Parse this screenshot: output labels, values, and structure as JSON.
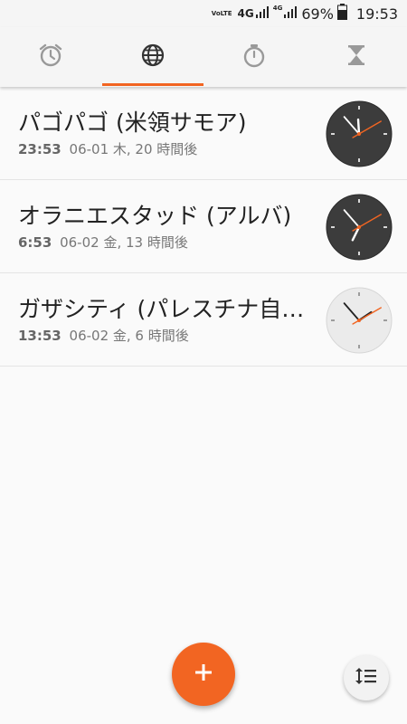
{
  "status_bar": {
    "volte": "VoLTE",
    "network1": "4G",
    "network2": "4G",
    "battery_percent": "69%",
    "time": "19:53"
  },
  "tabs": [
    {
      "name": "alarm",
      "icon": "alarm-clock-icon",
      "active": false
    },
    {
      "name": "world-clock",
      "icon": "globe-icon",
      "active": true
    },
    {
      "name": "stopwatch",
      "icon": "stopwatch-icon",
      "active": false
    },
    {
      "name": "timer",
      "icon": "hourglass-icon",
      "active": false
    }
  ],
  "cities": [
    {
      "name": "パゴパゴ (米領サモア)",
      "time": "23:53",
      "detail": "06-01 木, 20 時間後",
      "clock_theme": "dark",
      "hour": 23,
      "minute": 53,
      "second": 10
    },
    {
      "name": "オラニエスタッド (アルバ)",
      "time": "6:53",
      "detail": "06-02 金, 13 時間後",
      "clock_theme": "dark",
      "hour": 6,
      "minute": 53,
      "second": 10
    },
    {
      "name": "ガザシティ (パレスチナ自治区)",
      "time": "13:53",
      "detail": "06-02 金, 6 時間後",
      "clock_theme": "light",
      "hour": 13,
      "minute": 53,
      "second": 10
    }
  ],
  "fab": {
    "add_icon": "plus-icon",
    "sort_icon": "sort-icon"
  },
  "colors": {
    "accent": "#f26522",
    "clock_dark": "#3c3c3c",
    "clock_light": "#ebebeb"
  }
}
